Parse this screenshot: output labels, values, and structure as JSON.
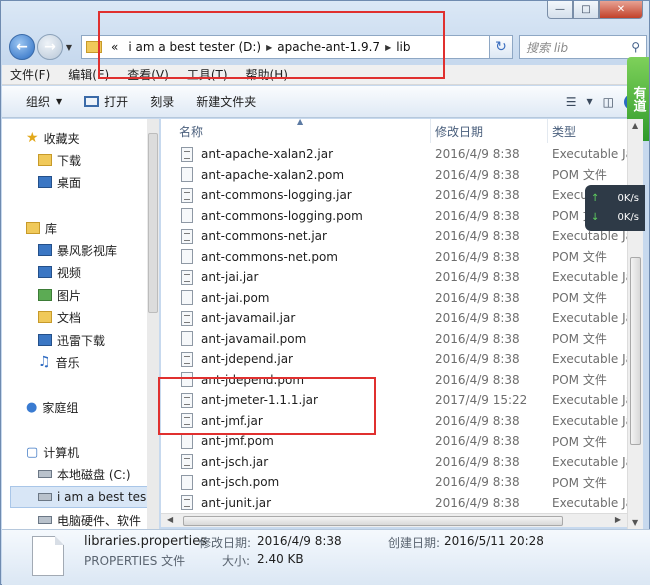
{
  "window": {
    "minimize": "—",
    "maximize": "□",
    "close": "✕"
  },
  "address": {
    "segments": [
      "«",
      "i am a  best tester (D:)",
      "apache-ant-1.9.7",
      "lib"
    ],
    "search_placeholder": "搜索 lib"
  },
  "menu": [
    "文件(F)",
    "编辑(E)",
    "查看(V)",
    "工具(T)",
    "帮助(H)"
  ],
  "toolbar": {
    "organize": "组织",
    "open": "打开",
    "burn": "刻录",
    "new_folder": "新建文件夹"
  },
  "side_tab": "有道",
  "speed": {
    "up_value": "0",
    "up_unit": "K/s",
    "down_value": "0",
    "down_unit": "K/s"
  },
  "nav": {
    "favorites": "收藏夹",
    "downloads": "下载",
    "desktop": "桌面",
    "libraries": "库",
    "storm": "暴风影视库",
    "videos": "视频",
    "pictures": "图片",
    "documents": "文档",
    "thunder": "迅雷下载",
    "music": "音乐",
    "homegroup": "家庭组",
    "computer": "计算机",
    "local_c": "本地磁盘 (C:)",
    "drive_d": "i am a  best tes",
    "drive_e": "电脑硬件、软件"
  },
  "columns": {
    "name": "名称",
    "date": "修改日期",
    "type": "类型"
  },
  "files": [
    {
      "name": "ant-apache-xalan2.jar",
      "date": "2016/4/9 8:38",
      "type": "Executable Ja",
      "kind": "jar"
    },
    {
      "name": "ant-apache-xalan2.pom",
      "date": "2016/4/9 8:38",
      "type": "POM 文件",
      "kind": "pom"
    },
    {
      "name": "ant-commons-logging.jar",
      "date": "2016/4/9 8:38",
      "type": "Executable Ja",
      "kind": "jar"
    },
    {
      "name": "ant-commons-logging.pom",
      "date": "2016/4/9 8:38",
      "type": "POM 文件",
      "kind": "pom"
    },
    {
      "name": "ant-commons-net.jar",
      "date": "2016/4/9 8:38",
      "type": "Executable Ja",
      "kind": "jar"
    },
    {
      "name": "ant-commons-net.pom",
      "date": "2016/4/9 8:38",
      "type": "POM 文件",
      "kind": "pom"
    },
    {
      "name": "ant-jai.jar",
      "date": "2016/4/9 8:38",
      "type": "Executable Ja",
      "kind": "jar"
    },
    {
      "name": "ant-jai.pom",
      "date": "2016/4/9 8:38",
      "type": "POM 文件",
      "kind": "pom"
    },
    {
      "name": "ant-javamail.jar",
      "date": "2016/4/9 8:38",
      "type": "Executable Ja",
      "kind": "jar"
    },
    {
      "name": "ant-javamail.pom",
      "date": "2016/4/9 8:38",
      "type": "POM 文件",
      "kind": "pom"
    },
    {
      "name": "ant-jdepend.jar",
      "date": "2016/4/9 8:38",
      "type": "Executable Ja",
      "kind": "jar"
    },
    {
      "name": "ant-jdepend.pom",
      "date": "2016/4/9 8:38",
      "type": "POM 文件",
      "kind": "pom"
    },
    {
      "name": "ant-jmeter-1.1.1.jar",
      "date": "2017/4/9 15:22",
      "type": "Executable Ja",
      "kind": "jar"
    },
    {
      "name": "ant-jmf.jar",
      "date": "2016/4/9 8:38",
      "type": "Executable Ja",
      "kind": "jar"
    },
    {
      "name": "ant-jmf.pom",
      "date": "2016/4/9 8:38",
      "type": "POM 文件",
      "kind": "pom"
    },
    {
      "name": "ant-jsch.jar",
      "date": "2016/4/9 8:38",
      "type": "Executable Ja",
      "kind": "jar"
    },
    {
      "name": "ant-jsch.pom",
      "date": "2016/4/9 8:38",
      "type": "POM 文件",
      "kind": "pom"
    },
    {
      "name": "ant-junit.jar",
      "date": "2016/4/9 8:38",
      "type": "Executable Ja",
      "kind": "jar"
    }
  ],
  "details": {
    "file_name": "libraries.properties",
    "file_type": "PROPERTIES 文件",
    "modified_label": "修改日期:",
    "modified_value": "2016/4/9 8:38",
    "created_label": "创建日期:",
    "created_value": "2016/5/11 20:28",
    "size_label": "大小:",
    "size_value": "2.40 KB"
  }
}
